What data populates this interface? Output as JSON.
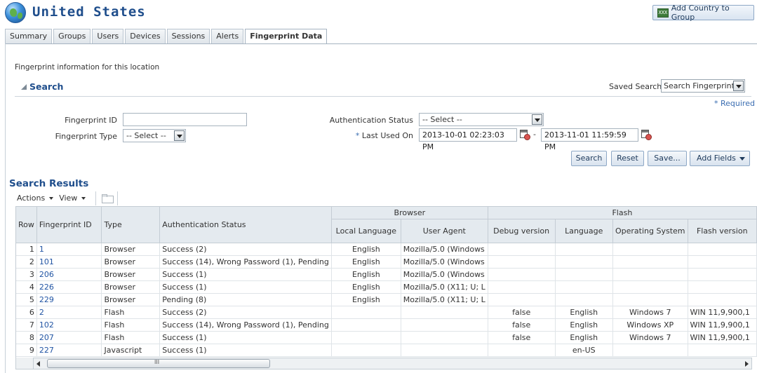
{
  "header": {
    "title": "United States",
    "add_button": "Add Country to Group"
  },
  "tabs": [
    "Summary",
    "Groups",
    "Users",
    "Devices",
    "Sessions",
    "Alerts",
    "Fingerprint Data"
  ],
  "active_tab": "Fingerprint Data",
  "intro": "Fingerprint information for this location",
  "search": {
    "title": "Search",
    "saved_search_label": "Saved Search",
    "saved_search_value": "Search Fingerprints",
    "required_label": "Required",
    "fingerprint_id_label": "Fingerprint ID",
    "fingerprint_id_value": "",
    "fingerprint_type_label": "Fingerprint Type",
    "fingerprint_type_value": "-- Select --",
    "auth_status_label": "Authentication Status",
    "auth_status_value": "-- Select --",
    "last_used_label": "Last Used On",
    "last_used_from": "2013-10-01 02:23:03 PM",
    "last_used_to": "2013-11-01 11:59:59 PM",
    "date_separator": "-",
    "buttons": {
      "search": "Search",
      "reset": "Reset",
      "save": "Save...",
      "add_fields": "Add Fields"
    }
  },
  "results": {
    "title": "Search Results",
    "actions": "Actions",
    "view": "View",
    "columns": {
      "row": "Row",
      "fingerprint_id": "Fingerprint ID",
      "type": "Type",
      "auth_status": "Authentication Status",
      "browser_group": "Browser",
      "local_language": "Local Language",
      "user_agent": "User Agent",
      "flash_group": "Flash",
      "debug_version": "Debug version",
      "language": "Language",
      "os": "Operating System",
      "flash_version": "Flash version"
    },
    "rows": [
      [
        "1",
        "1",
        "Browser",
        "Success (2)",
        "English",
        "Mozilla/5.0 (Windows",
        "",
        "",
        "",
        ""
      ],
      [
        "2",
        "101",
        "Browser",
        "Success (14), Wrong Password (1), Pending",
        "English",
        "Mozilla/5.0 (Windows",
        "",
        "",
        "",
        ""
      ],
      [
        "3",
        "206",
        "Browser",
        "Success (1)",
        "English",
        "Mozilla/5.0 (Windows",
        "",
        "",
        "",
        ""
      ],
      [
        "4",
        "226",
        "Browser",
        "Success (1)",
        "English",
        "Mozilla/5.0 (X11; U; L",
        "",
        "",
        "",
        ""
      ],
      [
        "5",
        "229",
        "Browser",
        "Pending (8)",
        "English",
        "Mozilla/5.0 (X11; U; L",
        "",
        "",
        "",
        ""
      ],
      [
        "6",
        "2",
        "Flash",
        "Success (2)",
        "",
        "",
        "false",
        "English",
        "Windows 7",
        "WIN 11,9,900,1"
      ],
      [
        "7",
        "102",
        "Flash",
        "Success (14), Wrong Password (1), Pending",
        "",
        "",
        "false",
        "English",
        "Windows XP",
        "WIN 11,9,900,1"
      ],
      [
        "8",
        "207",
        "Flash",
        "Success (1)",
        "",
        "",
        "false",
        "English",
        "Windows 7",
        "WIN 11,9,900,1"
      ],
      [
        "9",
        "227",
        "Javascript",
        "Success (1)",
        "",
        "",
        "",
        "en-US",
        "",
        ""
      ]
    ]
  }
}
